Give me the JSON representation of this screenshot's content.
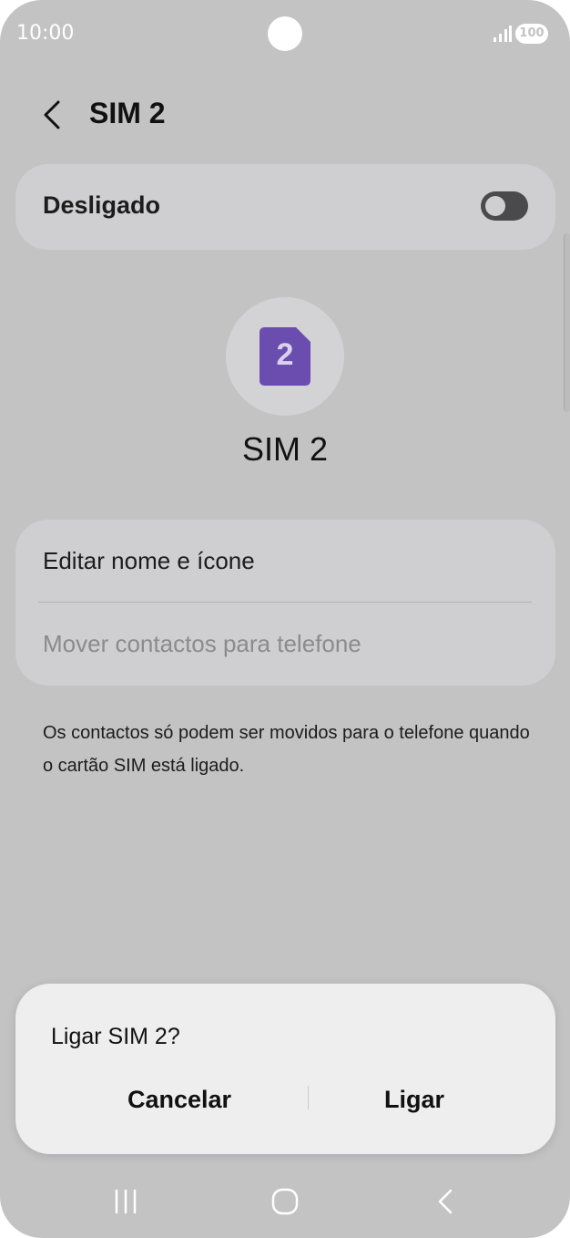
{
  "status_bar": {
    "time": "10:00",
    "battery": "100",
    "signal_icon": "signal-bars-icon"
  },
  "header": {
    "back_icon": "chevron-left-icon",
    "title": "SIM 2"
  },
  "sim_toggle": {
    "label": "Desligado",
    "state": "off"
  },
  "sim_card": {
    "icon": "sim-card-icon",
    "digit": "2",
    "icon_color": "#6b4db0",
    "name": "SIM 2"
  },
  "options": {
    "edit_label": "Editar nome e ícone",
    "move_label": "Mover contactos para telefone"
  },
  "help_text": "Os contactos só podem ser movidos para o telefone quando o cartão SIM está ligado.",
  "dialog": {
    "title": "Ligar SIM 2?",
    "cancel_label": "Cancelar",
    "confirm_label": "Ligar"
  },
  "nav_bar": {
    "recent_icon": "recent-apps-icon",
    "home_icon": "home-icon",
    "back_icon": "back-icon"
  }
}
